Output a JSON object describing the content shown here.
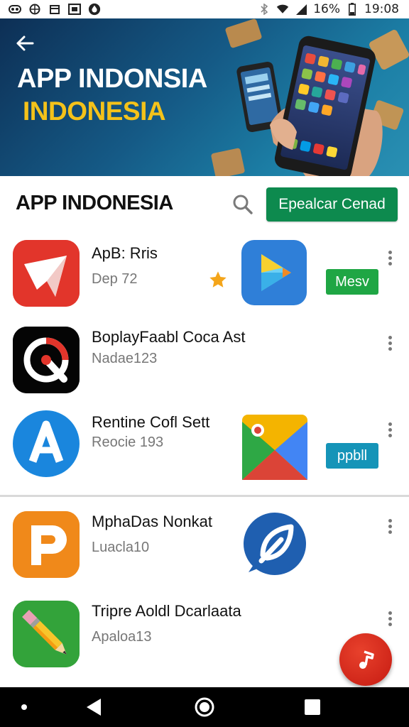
{
  "status_bar": {
    "battery": "16%",
    "time": "19:08"
  },
  "banner": {
    "title_line1": "APP INDONSIA",
    "title_line2": "INDONESIA"
  },
  "toolbar": {
    "title": "APP INDONESIA",
    "action_label": "Epealcar Cenad"
  },
  "apps": [
    {
      "title": "ApB: Rris",
      "subtitle": "Dep 72",
      "tag": "Mesv",
      "tag_color": "#1fa644",
      "has_star": true
    },
    {
      "title": "BoplayFaabl Coca Ast",
      "subtitle": "Nadae123"
    },
    {
      "title": "Rentine Cofl Sett",
      "subtitle": "Reocie 193",
      "tag": "ppbll",
      "tag_color": "#1594b8"
    },
    {
      "title": "MphaDas Nonkat",
      "subtitle": "Luacla10"
    },
    {
      "title": "Tripre Aoldl Dcarlaata",
      "subtitle": "Apaloa13"
    }
  ],
  "colors": {
    "primary_green": "#0d8a4e",
    "fab_red": "#d3261a",
    "banner_yellow": "#f4c21a"
  }
}
